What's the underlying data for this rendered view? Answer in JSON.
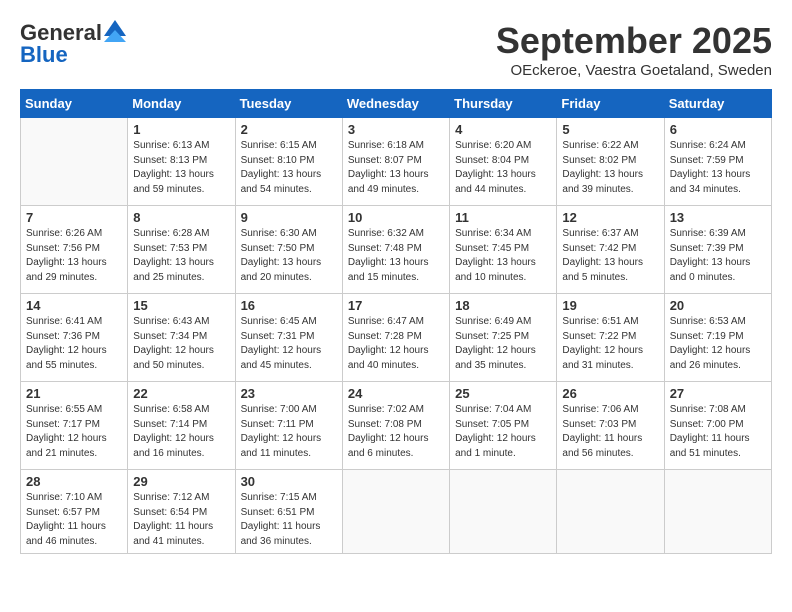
{
  "header": {
    "logo_line1": "General",
    "logo_line2": "Blue",
    "month_title": "September 2025",
    "location": "OEckeroe, Vaestra Goetaland, Sweden"
  },
  "weekdays": [
    "Sunday",
    "Monday",
    "Tuesday",
    "Wednesday",
    "Thursday",
    "Friday",
    "Saturday"
  ],
  "weeks": [
    [
      {
        "day": "",
        "info": ""
      },
      {
        "day": "1",
        "info": "Sunrise: 6:13 AM\nSunset: 8:13 PM\nDaylight: 13 hours\nand 59 minutes."
      },
      {
        "day": "2",
        "info": "Sunrise: 6:15 AM\nSunset: 8:10 PM\nDaylight: 13 hours\nand 54 minutes."
      },
      {
        "day": "3",
        "info": "Sunrise: 6:18 AM\nSunset: 8:07 PM\nDaylight: 13 hours\nand 49 minutes."
      },
      {
        "day": "4",
        "info": "Sunrise: 6:20 AM\nSunset: 8:04 PM\nDaylight: 13 hours\nand 44 minutes."
      },
      {
        "day": "5",
        "info": "Sunrise: 6:22 AM\nSunset: 8:02 PM\nDaylight: 13 hours\nand 39 minutes."
      },
      {
        "day": "6",
        "info": "Sunrise: 6:24 AM\nSunset: 7:59 PM\nDaylight: 13 hours\nand 34 minutes."
      }
    ],
    [
      {
        "day": "7",
        "info": "Sunrise: 6:26 AM\nSunset: 7:56 PM\nDaylight: 13 hours\nand 29 minutes."
      },
      {
        "day": "8",
        "info": "Sunrise: 6:28 AM\nSunset: 7:53 PM\nDaylight: 13 hours\nand 25 minutes."
      },
      {
        "day": "9",
        "info": "Sunrise: 6:30 AM\nSunset: 7:50 PM\nDaylight: 13 hours\nand 20 minutes."
      },
      {
        "day": "10",
        "info": "Sunrise: 6:32 AM\nSunset: 7:48 PM\nDaylight: 13 hours\nand 15 minutes."
      },
      {
        "day": "11",
        "info": "Sunrise: 6:34 AM\nSunset: 7:45 PM\nDaylight: 13 hours\nand 10 minutes."
      },
      {
        "day": "12",
        "info": "Sunrise: 6:37 AM\nSunset: 7:42 PM\nDaylight: 13 hours\nand 5 minutes."
      },
      {
        "day": "13",
        "info": "Sunrise: 6:39 AM\nSunset: 7:39 PM\nDaylight: 13 hours\nand 0 minutes."
      }
    ],
    [
      {
        "day": "14",
        "info": "Sunrise: 6:41 AM\nSunset: 7:36 PM\nDaylight: 12 hours\nand 55 minutes."
      },
      {
        "day": "15",
        "info": "Sunrise: 6:43 AM\nSunset: 7:34 PM\nDaylight: 12 hours\nand 50 minutes."
      },
      {
        "day": "16",
        "info": "Sunrise: 6:45 AM\nSunset: 7:31 PM\nDaylight: 12 hours\nand 45 minutes."
      },
      {
        "day": "17",
        "info": "Sunrise: 6:47 AM\nSunset: 7:28 PM\nDaylight: 12 hours\nand 40 minutes."
      },
      {
        "day": "18",
        "info": "Sunrise: 6:49 AM\nSunset: 7:25 PM\nDaylight: 12 hours\nand 35 minutes."
      },
      {
        "day": "19",
        "info": "Sunrise: 6:51 AM\nSunset: 7:22 PM\nDaylight: 12 hours\nand 31 minutes."
      },
      {
        "day": "20",
        "info": "Sunrise: 6:53 AM\nSunset: 7:19 PM\nDaylight: 12 hours\nand 26 minutes."
      }
    ],
    [
      {
        "day": "21",
        "info": "Sunrise: 6:55 AM\nSunset: 7:17 PM\nDaylight: 12 hours\nand 21 minutes."
      },
      {
        "day": "22",
        "info": "Sunrise: 6:58 AM\nSunset: 7:14 PM\nDaylight: 12 hours\nand 16 minutes."
      },
      {
        "day": "23",
        "info": "Sunrise: 7:00 AM\nSunset: 7:11 PM\nDaylight: 12 hours\nand 11 minutes."
      },
      {
        "day": "24",
        "info": "Sunrise: 7:02 AM\nSunset: 7:08 PM\nDaylight: 12 hours\nand 6 minutes."
      },
      {
        "day": "25",
        "info": "Sunrise: 7:04 AM\nSunset: 7:05 PM\nDaylight: 12 hours\nand 1 minute."
      },
      {
        "day": "26",
        "info": "Sunrise: 7:06 AM\nSunset: 7:03 PM\nDaylight: 11 hours\nand 56 minutes."
      },
      {
        "day": "27",
        "info": "Sunrise: 7:08 AM\nSunset: 7:00 PM\nDaylight: 11 hours\nand 51 minutes."
      }
    ],
    [
      {
        "day": "28",
        "info": "Sunrise: 7:10 AM\nSunset: 6:57 PM\nDaylight: 11 hours\nand 46 minutes."
      },
      {
        "day": "29",
        "info": "Sunrise: 7:12 AM\nSunset: 6:54 PM\nDaylight: 11 hours\nand 41 minutes."
      },
      {
        "day": "30",
        "info": "Sunrise: 7:15 AM\nSunset: 6:51 PM\nDaylight: 11 hours\nand 36 minutes."
      },
      {
        "day": "",
        "info": ""
      },
      {
        "day": "",
        "info": ""
      },
      {
        "day": "",
        "info": ""
      },
      {
        "day": "",
        "info": ""
      }
    ]
  ]
}
